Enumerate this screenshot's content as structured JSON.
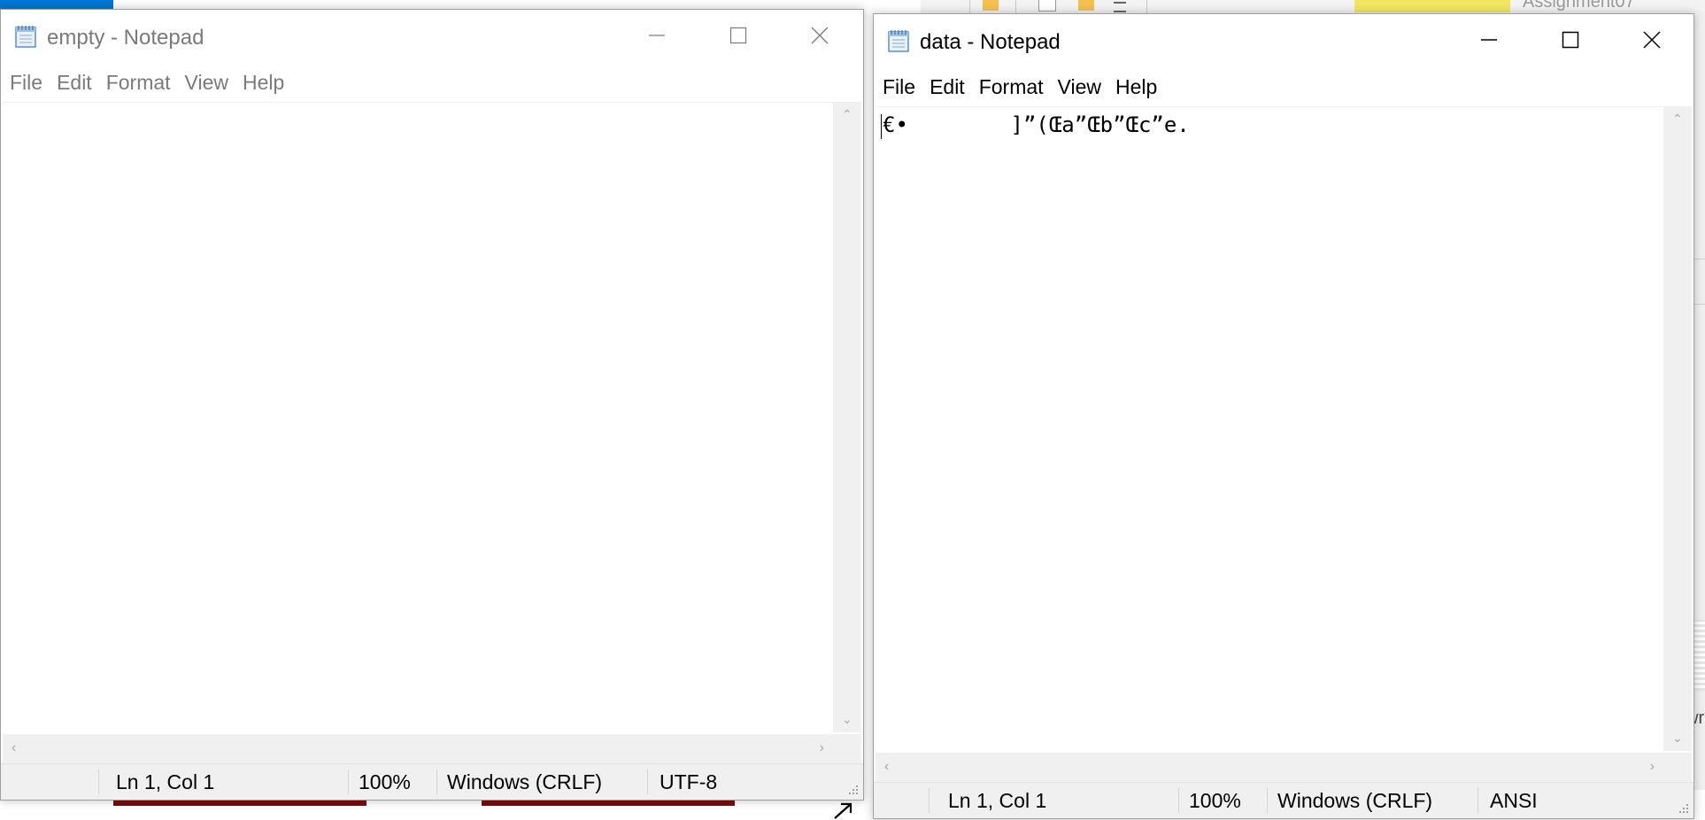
{
  "background": {
    "explorer_tab_text": "Assignment07",
    "edge_text": "wr"
  },
  "windows": [
    {
      "title": "empty - Notepad",
      "state": "inactive",
      "menu": [
        "File",
        "Edit",
        "Format",
        "View",
        "Help"
      ],
      "content": "",
      "status": {
        "position": "Ln 1, Col 1",
        "zoom": "100%",
        "line_endings": "Windows (CRLF)",
        "encoding": "UTF-8"
      }
    },
    {
      "title": "data - Notepad",
      "state": "active",
      "menu": [
        "File",
        "Edit",
        "Format",
        "View",
        "Help"
      ],
      "content": "€\u0001•\u0001        ]”(Œ\u0001a”Œ\u0001b”Œ\u0001c”e.",
      "status": {
        "position": "Ln 1, Col 1",
        "zoom": "100%",
        "line_endings": "Windows (CRLF)",
        "encoding": "ANSI"
      }
    }
  ],
  "icons": {
    "app": "notepad-icon",
    "minimize": "minimize-icon",
    "maximize": "maximize-icon",
    "close": "close-icon"
  }
}
